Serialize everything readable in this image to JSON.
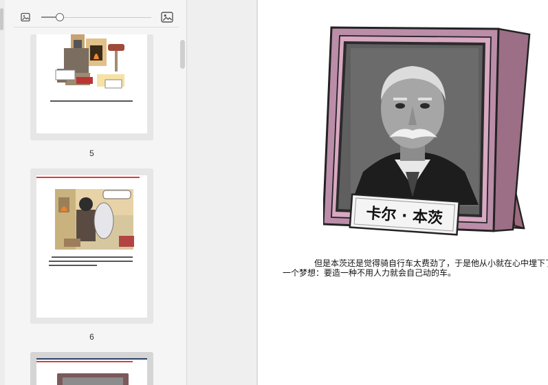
{
  "sidebar": {
    "toolbar": {
      "left_icon": "image-small-icon",
      "right_icon": "image-large-icon",
      "zoom_fraction": 0.17
    },
    "pages": [
      {
        "number": "5",
        "caption": ""
      },
      {
        "number": "6",
        "speech_bubble": ""
      },
      {
        "number": ""
      }
    ]
  },
  "document": {
    "plaque_text": "卡尔 · 本茨",
    "paragraph_line1": "但是本茨还是觉得骑自行车太费劲了，于是他从小就在心中埋下了",
    "paragraph_line2": "一个梦想：要造一种不用人力就会自己动的车。"
  }
}
